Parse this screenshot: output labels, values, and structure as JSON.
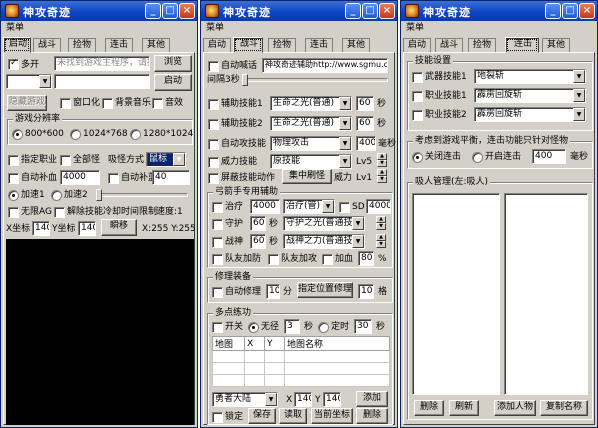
{
  "app": {
    "title": "神攻奇迹",
    "menu": "菜单",
    "tabs": [
      "启动",
      "战斗",
      "捡物",
      "连击",
      "其他"
    ],
    "minimize": "_",
    "maximize": "□",
    "close": "×"
  },
  "launch": {
    "multi_open": "多开",
    "path_placeholder": "未找到游戏主程序，请按",
    "browse": "浏览",
    "start": "启动",
    "hide_game": "隐藏游戏",
    "windowed": "窗口化",
    "bg_music": "背景音乐",
    "sound": "音效",
    "resolution_title": "游戏分辨率",
    "resolutions": [
      "800*600",
      "1024*768",
      "1280*1024"
    ],
    "assign_skill": "指定职业",
    "all_monsters": "全部怪",
    "suck_mode_label": "吸怪方式",
    "suck_mode_value": "鼠标",
    "auto_hp": "自动补血",
    "auto_hp_value": "4000",
    "auto_mp": "自动补蓝",
    "auto_mp_value": "40",
    "speedup1": "加速1",
    "speedup2": "加速2",
    "no_ag": "无限AG",
    "unlock_cd": "解除技能冷却时间限制",
    "speed_label": "速度:1",
    "x_label": "X坐标",
    "x_value": "140",
    "y_label": "Y坐标",
    "y_value": "140",
    "teleport": "瞬移",
    "coord_readout": "X:255  Y:255"
  },
  "combat": {
    "auto_shout": "自动喊话",
    "shout_text": "神攻奇迹辅助http://www.sgmu.cc",
    "interval_label": "间隔3秒",
    "skills": [
      {
        "label": "辅助技能1",
        "value": "生命之光(普通)",
        "num": "60",
        "unit": "秒"
      },
      {
        "label": "辅助技能2",
        "value": "生命之光(普通)",
        "num": "60",
        "unit": "秒"
      },
      {
        "label": "自动攻技能",
        "value": "物理攻击",
        "num": "400",
        "unit": "毫秒"
      }
    ],
    "power_skill": "威力技能",
    "power_value": "原技能",
    "lv5": "Lv5",
    "block_action": "屏蔽技能动作",
    "focus_kill": "集中刷怪",
    "power_lv1": "威力",
    "lv1": "Lv1",
    "archer_title": "弓箭手专用辅助",
    "heal": "治疗",
    "heal_value": "4000",
    "heal_target": "治疗(管)",
    "sd": "SD",
    "sd_value": "4000",
    "guard": "守护",
    "guard_num": "60",
    "guard_unit": "秒",
    "guard_skill": "守护之光(普通技能)",
    "war_god": "战神",
    "war_num": "60",
    "war_unit": "秒",
    "war_skill": "战神之力(普通技能)",
    "party_help": "队友加防",
    "party_atk": "队友加攻",
    "add_hp": "加血",
    "hp_pct": "80",
    "pct": "%",
    "repair_title": "修理装备",
    "auto_repair": "自动修理",
    "repair_num": "10",
    "repair_unit": "分",
    "assign_pos": "指定位置修理",
    "grid_num": "10",
    "grid_unit": "格",
    "multipoint_title": "多点练功",
    "switch_label": "开关",
    "no_interval": "无径",
    "interval_num": "3",
    "sec": "秒",
    "timed": "定时",
    "timed_num": "30",
    "table_headers": [
      "地图",
      "X",
      "Y",
      "地图名称"
    ],
    "map_select": "勇者大陆",
    "x_label": "X",
    "x_value": "140",
    "y_label": "Y",
    "y_value": "140",
    "add": "添加",
    "lock": "锁定",
    "save": "保存",
    "read": "读取",
    "current_coord": "当前坐标",
    "delete": "删除"
  },
  "combo": {
    "skill_settings_title": "技能设置",
    "weapon_skill1": "武器技能1",
    "weapon_skill1_value": "地裂斩",
    "job_skill1": "职业技能1",
    "job_skill1_value": "霹雳回旋斩",
    "job_skill2": "职业技能2",
    "job_skill2_value": "霹雳回旋斩",
    "balance_title": "考虑到游戏平衡，连击功能只针对怪物",
    "close_combo": "关闭连击",
    "open_combo": "开启连击",
    "combo_ms": "400",
    "ms": "毫秒",
    "suck_title": "吸人管理(左:吸人)",
    "delete": "删除",
    "refresh": "刷新",
    "add_person": "添加人物",
    "copy_name": "复制名称"
  }
}
